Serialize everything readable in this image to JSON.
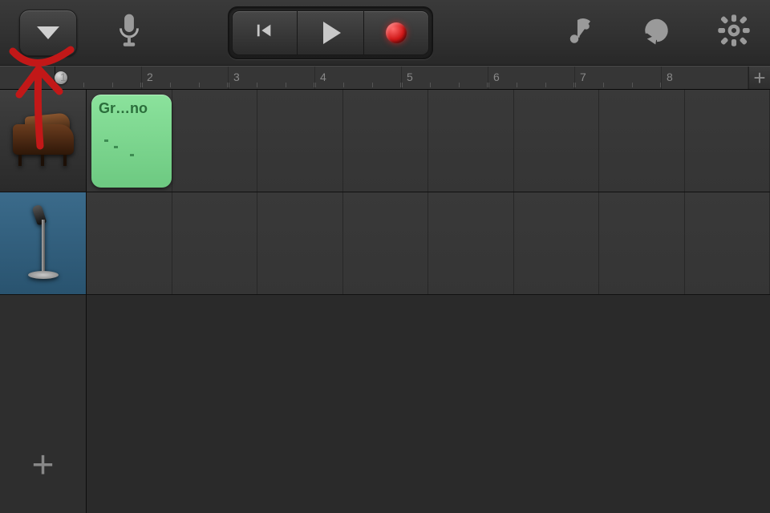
{
  "toolbar": {
    "dropdown_label": "",
    "transport": {
      "rewind": "Go to Beginning",
      "play": "Play",
      "record": "Record"
    },
    "icons": {
      "mic": "microphone-icon",
      "instruments": "instruments-icon",
      "loop": "loop-icon",
      "settings": "settings-icon"
    }
  },
  "ruler": {
    "measures": [
      "1",
      "2",
      "3",
      "4",
      "5",
      "6",
      "7",
      "8"
    ],
    "add_section_label": "+"
  },
  "tracks": [
    {
      "id": "track-piano",
      "instrument": "Grand Piano",
      "selected": false
    },
    {
      "id": "track-vocal",
      "instrument": "Audio Recorder",
      "selected": true
    }
  ],
  "regions": [
    {
      "track": 0,
      "start_measure": 1,
      "length_measures": 1,
      "label": "Gr…no",
      "color": "#7ed591"
    }
  ],
  "add_track_label": "+",
  "playhead_measure": 1,
  "annotation": {
    "type": "hand-drawn-arrow",
    "target": "dropdown-button",
    "color": "#c21818"
  }
}
